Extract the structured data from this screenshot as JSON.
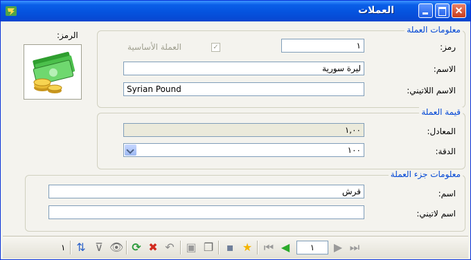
{
  "window": {
    "title": "العملات"
  },
  "symbol": {
    "label": "الرمز:"
  },
  "currency_info": {
    "legend": "معلومات العملة",
    "code_label": "رمز:",
    "code_value": "١",
    "base_currency_label": "العملة الأساسية",
    "base_currency_checked": true,
    "name_label": "الاسم:",
    "name_value": "ليرة سورية",
    "latin_name_label": "الاسم اللاتيني:",
    "latin_name_value": "Syrian Pound"
  },
  "currency_value": {
    "legend": "قيمة العملة",
    "rate_label": "المعادل:",
    "rate_value": "١,٠٠",
    "precision_label": "الدقة:",
    "precision_value": "١٠٠"
  },
  "sub_currency": {
    "legend": "معلومات جزء العملة",
    "name_label": "اسم:",
    "name_value": "قرش",
    "latin_name_label": "اسم لاتيني:",
    "latin_name_value": ""
  },
  "toolbar": {
    "record_number": "١",
    "record_count": "١",
    "icons": [
      "first-record-icon",
      "prev-record-icon",
      "next-record-icon",
      "last-record-icon",
      "favorite-icon",
      "save-icon",
      "copy-icon",
      "paste-icon",
      "undo-icon",
      "delete-icon",
      "refresh-icon",
      "view-icon",
      "filter-icon",
      "sort-icon"
    ]
  },
  "colors": {
    "titlebar": "#0553de",
    "legend": "#0046d5",
    "close": "#c83c1b"
  }
}
